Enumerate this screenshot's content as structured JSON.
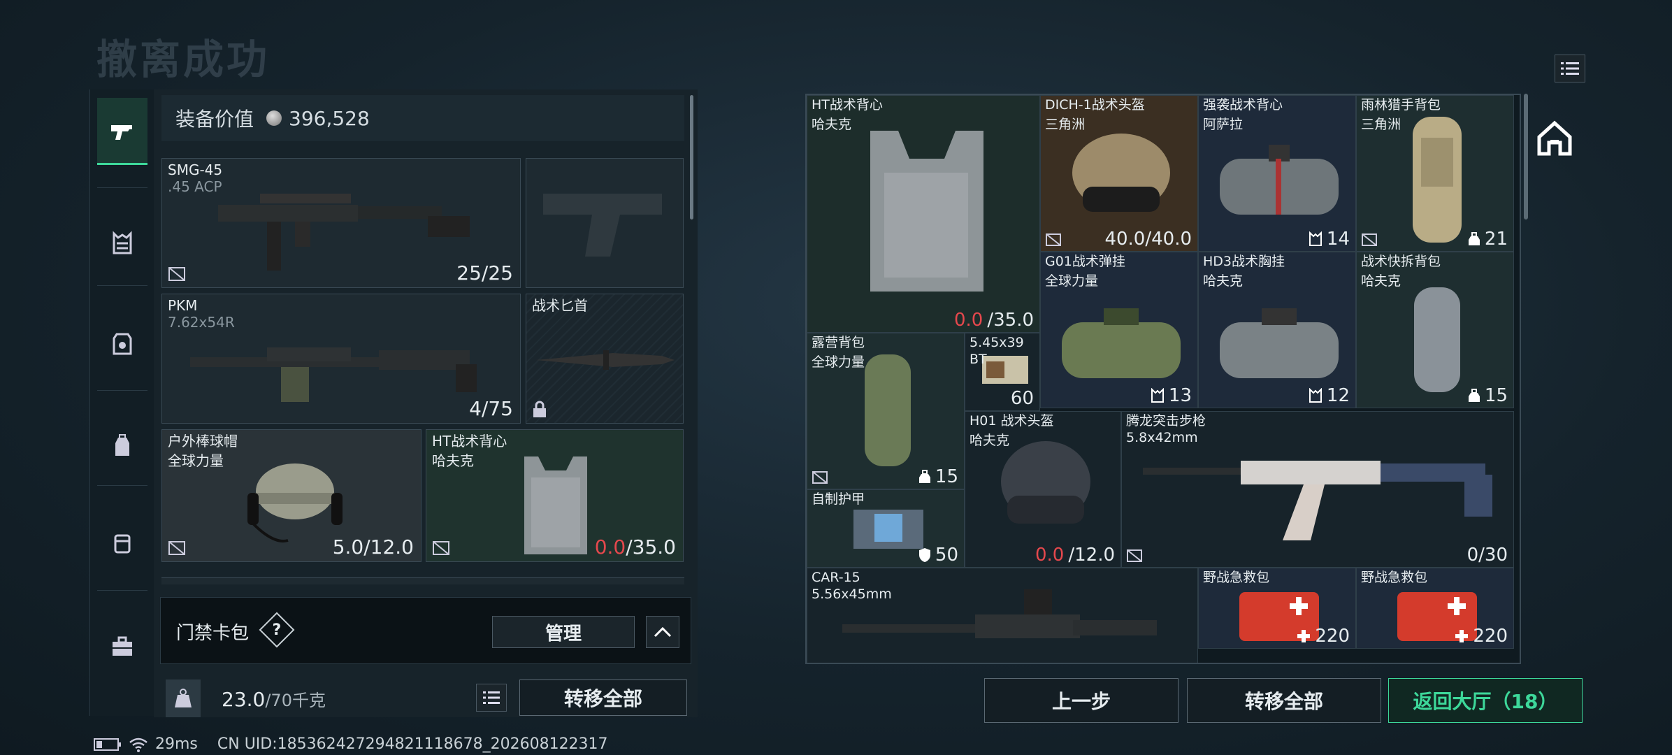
{
  "header": {
    "title": "撤离成功"
  },
  "loadout": {
    "value_label": "装备价值",
    "value": "396,528",
    "slots": [
      {
        "name": "SMG-45",
        "sub": ".45 ACP",
        "count": "25/25"
      },
      {
        "name": "",
        "sub": "",
        "count": ""
      },
      {
        "name": "PKM",
        "sub": "7.62x54R",
        "count": "4/75"
      },
      {
        "name": "战术匕首",
        "sub": "",
        "count": ""
      },
      {
        "name": "户外棒球帽",
        "sub": "全球力量",
        "count": "5.0/12.0"
      },
      {
        "name": "HT战术背心",
        "sub": "哈夫克",
        "count_red": "0.0",
        "count_rest": "/35.0"
      }
    ],
    "card_label": "门禁卡包",
    "help": "?",
    "manage_label": "管理",
    "weight": "23.0",
    "weight_max": "/70千克",
    "transfer_all": "转移全部"
  },
  "status": {
    "ping": "29ms",
    "uid": "CN UID:18536242729482111867​8_202608122317"
  },
  "loot": {
    "items": [
      {
        "name": "HT战术背心",
        "sub": "哈夫克",
        "count_red": "0.0",
        "count_rest": "/35.0"
      },
      {
        "name": "DICH-1战术头盔",
        "sub": "三角洲",
        "count": "40.0/40.0"
      },
      {
        "name": "强袭战术背心",
        "sub": "阿萨拉",
        "count": "14"
      },
      {
        "name": "雨林猎手背包",
        "sub": "三角洲",
        "count": "21"
      },
      {
        "name": "G01战术弹挂",
        "sub": "全球力量",
        "count": "13"
      },
      {
        "name": "HD3战术胸挂",
        "sub": "哈夫克",
        "count": "12"
      },
      {
        "name": "战术快拆背包",
        "sub": "哈夫克",
        "count": "15"
      },
      {
        "name": "露营背包",
        "sub": "全球力量",
        "count": "15"
      },
      {
        "name": "5.45x39",
        "sub": "BT",
        "count": "60"
      },
      {
        "name": "H01 战术头盔",
        "sub": "哈夫克",
        "count_red": "0.0",
        "count_rest": "/12.0"
      },
      {
        "name": "腾龙突击步枪",
        "sub": "5.8x42mm",
        "count": "0/30"
      },
      {
        "name": "自制护甲",
        "sub": "",
        "count": "50"
      },
      {
        "name": "CAR-15",
        "sub": "5.56x45mm",
        "count": ""
      },
      {
        "name": "野战急救包",
        "sub": "",
        "count": "220"
      },
      {
        "name": "野战急救包",
        "sub": "",
        "count": "220"
      }
    ],
    "prev_step": "上一步",
    "transfer_all": "转移全部",
    "return_lobby": "返回大厅（18）"
  },
  "icons": {
    "accent": "#3dd89a",
    "red": "#e5484d"
  }
}
